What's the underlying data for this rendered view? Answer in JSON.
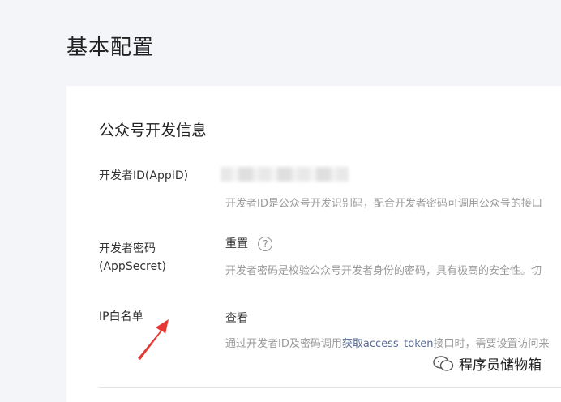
{
  "page": {
    "title": "基本配置"
  },
  "section": {
    "title": "公众号开发信息",
    "rows": [
      {
        "label": "开发者ID(AppID)",
        "desc": "开发者ID是公众号开发识别码，配合开发者密码可调用公众号的接口"
      },
      {
        "label_line1": "开发者密码",
        "label_line2": "(AppSecret)",
        "action": "重置",
        "help": "?",
        "desc": "开发者密码是校验公众号开发者身份的密码，具有极高的安全性。切"
      },
      {
        "label": "IP白名单",
        "action": "查看",
        "desc_prefix": "通过开发者ID及密码调用",
        "desc_link": "获取access_token",
        "desc_suffix": "接口时，需要设置访问来"
      }
    ]
  },
  "watermark": {
    "text": "程序员储物箱",
    "icon": "wechat-icon"
  },
  "colors": {
    "arrow": "#e53935",
    "link": "#576b95",
    "background": "#f4f5f9"
  }
}
